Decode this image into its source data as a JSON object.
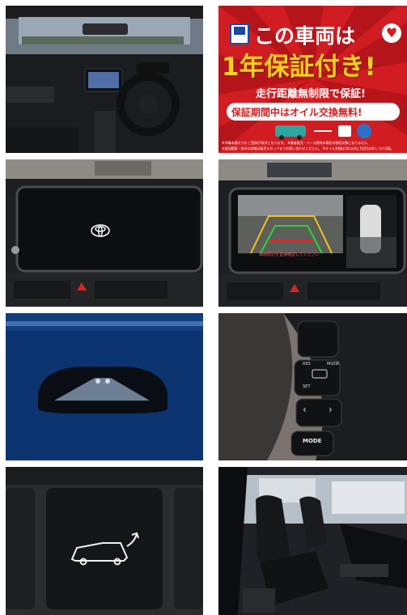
{
  "promo": {
    "line1": "この車両は",
    "line2": "1年保証付き!",
    "line3": "走行距離無制限で保証!",
    "line4": "保証期間中はオイル交換無料!",
    "note1": "※沖縄本島内での ご登録が条件となります。 ※業者販売・リース契約の場合は保証対象となりません",
    "note2": "※保証範囲・条件の詳細は販売スタッフまでお問い合わせください。 ※オイル交換は1年以内に1回目お申しつけ可能。"
  },
  "camera_warning": "車両周辺を直接確認してください",
  "steering_labels": {
    "res": "RES",
    "set": "SET",
    "mode_small": "MODE",
    "mode_button": "MODE"
  },
  "colors": {
    "promo_red": "#d11d22",
    "promo_yellow": "#f7d21d",
    "car_blue": "#0d3a78"
  }
}
